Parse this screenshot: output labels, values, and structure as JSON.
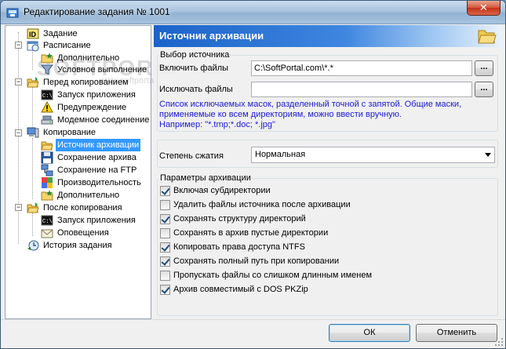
{
  "window": {
    "title": "Редактирование задания № 1001",
    "close": "✕"
  },
  "watermark": {
    "main": "SOFTPORTAL",
    "sub": "www.softportal.com"
  },
  "tree": {
    "items": [
      {
        "label": "Задание",
        "icon": "id-icon"
      },
      {
        "label": "Расписание",
        "icon": "schedule-icon"
      },
      {
        "label": "Дополнительно",
        "icon": "folder-star-icon"
      },
      {
        "label": "Условное выполнение",
        "icon": "filter-icon"
      },
      {
        "label": "Перед копированием",
        "icon": "folder-open-icon"
      },
      {
        "label": "Запуск приложения",
        "icon": "console-icon"
      },
      {
        "label": "Предупреждение",
        "icon": "warning-icon"
      },
      {
        "label": "Модемное соединение",
        "icon": "modem-icon"
      },
      {
        "label": "Копирование",
        "icon": "computer-icon"
      },
      {
        "label": "Источник архивации",
        "icon": "folder-open-icon"
      },
      {
        "label": "Сохранение архива",
        "icon": "floppy-icon"
      },
      {
        "label": "Сохранение на FTP",
        "icon": "network-icon"
      },
      {
        "label": "Производительность",
        "icon": "puzzle-icon"
      },
      {
        "label": "Дополнительно",
        "icon": "folder-star-icon"
      },
      {
        "label": "После копирования",
        "icon": "folder-open-icon"
      },
      {
        "label": "Запуск приложения",
        "icon": "console-icon"
      },
      {
        "label": "Оповещения",
        "icon": "mail-icon"
      },
      {
        "label": "История задания",
        "icon": "history-icon"
      }
    ]
  },
  "panel": {
    "title": "Источник архивации",
    "source_group": "Выбор источника",
    "include_label": "Включить файлы",
    "include_value": "C:\\SoftPortal.com\\*.*",
    "exclude_label": "Исключать файлы",
    "exclude_value": "",
    "browse": "...",
    "hint_line1": "Список исключаемых масок, разделенный точной с запятой. Общие маски,",
    "hint_line2": "применяемые ко всем директориям, можно ввести вручную.",
    "hint_line3": "Например: \"*.tmp;*.doc; *.jpg\"",
    "compression_label": "Степень сжатия",
    "compression_value": "Нормальная",
    "params_group": "Параметры архивации",
    "options": [
      {
        "label": "Включая субдиректории",
        "checked": true
      },
      {
        "label": "Удалить файлы источника после архивации",
        "checked": false
      },
      {
        "label": "Сохранять структуру директорий",
        "checked": true
      },
      {
        "label": "Сохранять в архив пустые директории",
        "checked": false
      },
      {
        "label": "Копировать права доступа NTFS",
        "checked": true
      },
      {
        "label": "Сохранять полный путь при копировании",
        "checked": true
      },
      {
        "label": "Пропускать файлы со слишком длинным именем",
        "checked": false
      },
      {
        "label": "Архив совместимый с DOS PKZip",
        "checked": true
      }
    ]
  },
  "footer": {
    "ok": "ОК",
    "cancel": "Отменить"
  }
}
